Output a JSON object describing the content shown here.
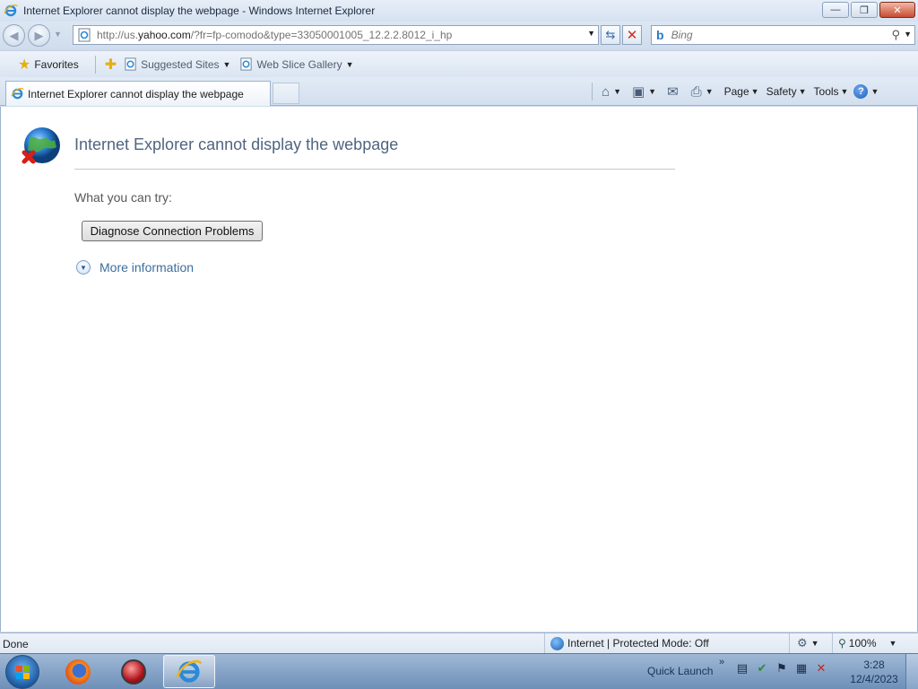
{
  "window": {
    "title": "Internet Explorer cannot display the webpage - Windows Internet Explorer",
    "controls": {
      "minimize": "—",
      "maximize": "❐",
      "close": "✕"
    }
  },
  "address": {
    "url_prefix": "http://us.",
    "url_domain": "yahoo.com",
    "url_suffix": "/?fr=fp-comodo&type=33050001005_12.2.2.8012_i_hp",
    "refresh_icon": "refresh-icon",
    "stop_icon": "stop-icon"
  },
  "search": {
    "placeholder": "Bing",
    "provider_icon": "bing-icon"
  },
  "favorites_bar": {
    "favorites_label": "Favorites",
    "links": [
      {
        "label": "Suggested Sites"
      },
      {
        "label": "Web Slice Gallery"
      }
    ]
  },
  "tabs": {
    "active_title": "Internet Explorer cannot display the webpage"
  },
  "command_bar": {
    "page_label": "Page",
    "safety_label": "Safety",
    "tools_label": "Tools",
    "help_label": "?"
  },
  "content": {
    "heading": "Internet Explorer cannot display the webpage",
    "try_label": "What you can try:",
    "diagnose_button": "Diagnose Connection Problems",
    "more_info": "More information"
  },
  "status_bar": {
    "status": "Done",
    "zone": "Internet | Protected Mode: Off",
    "zoom": "100%"
  },
  "taskbar": {
    "quick_launch": "Quick Launch",
    "time": "3:28",
    "date": "12/4/2023"
  },
  "colors": {
    "chrome_bg": "#cfdcec",
    "heading_text": "#4f6580",
    "link_text": "#3c6e9e",
    "close_button": "#c74c33"
  }
}
